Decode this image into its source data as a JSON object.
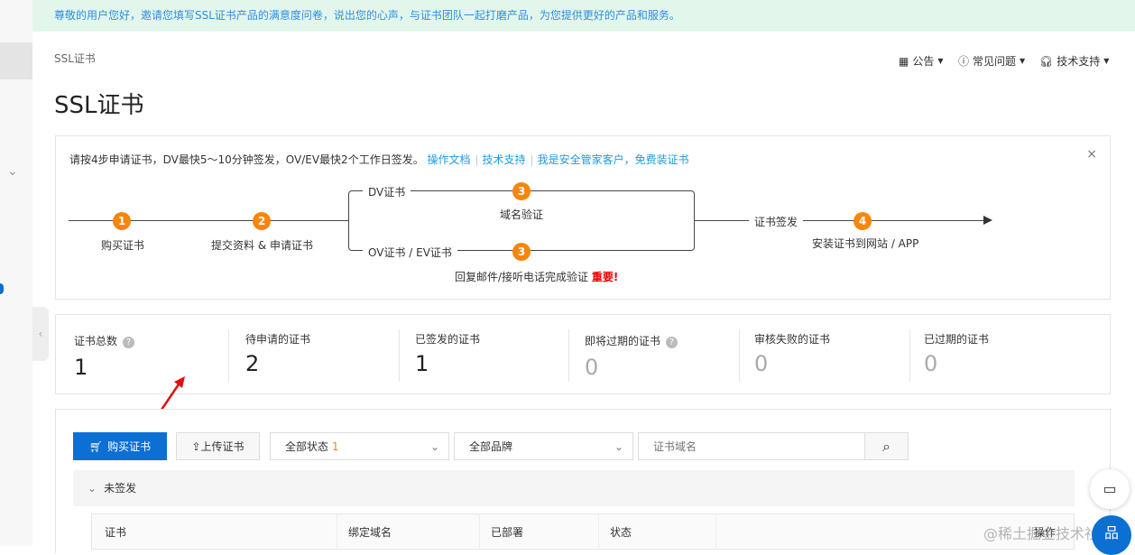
{
  "banner": "尊敬的用户您好，邀请您填写SSL证书产品的满意度问卷，说出您的心声，与证书团队一起打磨产品，为您提供更好的产品和服务。",
  "breadcrumb": "SSL证书",
  "title": "SSL证书",
  "top_menu": [
    {
      "label": "公告"
    },
    {
      "label": "常见问题"
    },
    {
      "label": "技术支持"
    }
  ],
  "guide": {
    "intro": "请按4步申请证书，DV最快5～10分钟签发，OV/EV最快2个工作日签发。",
    "links": [
      "操作文档",
      "技术支持",
      "我是安全管家客户，免费装证书"
    ],
    "steps": {
      "s1_num": "1",
      "s1": "购买证书",
      "s2_num": "2",
      "s2": "提交资料 & 申请证书",
      "dv": "DV证书",
      "dv_num": "3",
      "dv_desc": "域名验证",
      "ovev": "OV证书 / EV证书",
      "ov_num": "3",
      "ov_desc": "回复邮件/接听电话完成验证",
      "important": "重要!",
      "issue": "证书签发",
      "s4_num": "4",
      "s4": "安装证书到网站 / APP"
    }
  },
  "stats": [
    {
      "label": "证书总数",
      "value": "1",
      "help": true
    },
    {
      "label": "待申请的证书",
      "value": "2"
    },
    {
      "label": "已签发的证书",
      "value": "1"
    },
    {
      "label": "即将过期的证书",
      "value": "0",
      "help": true
    },
    {
      "label": "审核失败的证书",
      "value": "0"
    },
    {
      "label": "已过期的证书",
      "value": "0"
    }
  ],
  "toolbar": {
    "buy": "购买证书",
    "upload": "上传证书",
    "status": "全部状态",
    "status_count": "1",
    "brand": "全部品牌",
    "search_placeholder": "证书域名"
  },
  "group": {
    "label": "未签发"
  },
  "table": {
    "columns": [
      "证书",
      "绑定域名",
      "已部署",
      "状态",
      "操作"
    ]
  },
  "watermark": "@稀土掘金技术社区",
  "colors": {
    "primary": "#0b6fd3",
    "orange": "#f7860b",
    "link": "#1e9bdf",
    "danger": "#e00"
  }
}
